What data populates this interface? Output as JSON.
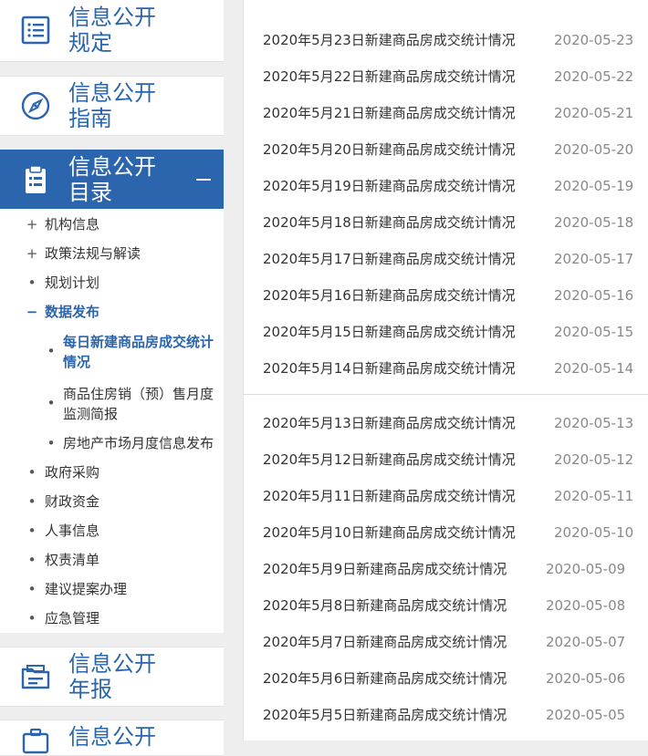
{
  "sidebar": {
    "sections": {
      "regulations": {
        "title_line1": "信息公开",
        "title_line2": "规定",
        "icon": "document-list-icon"
      },
      "guide": {
        "title_line1": "信息公开",
        "title_line2": "指南",
        "icon": "compass-icon"
      },
      "catalog": {
        "title_line1": "信息公开",
        "title_line2": "目录",
        "icon": "clipboard-icon",
        "expanded": true
      },
      "annual_report": {
        "title_line1": "信息公开",
        "title_line2": "年报",
        "icon": "folder-icon"
      },
      "next": {
        "title_line1": "信息公开",
        "icon": "briefcase-icon"
      }
    },
    "tree": {
      "items": [
        {
          "marker": "+",
          "label": "机构信息"
        },
        {
          "marker": "+",
          "label": "政策法规与解读"
        },
        {
          "marker": "•",
          "label": "规划计划"
        },
        {
          "marker": "−",
          "label": "数据发布"
        },
        {
          "marker": "•",
          "label": "政府采购"
        },
        {
          "marker": "•",
          "label": "财政资金"
        },
        {
          "marker": "•",
          "label": "人事信息"
        },
        {
          "marker": "•",
          "label": "权责清单"
        },
        {
          "marker": "•",
          "label": "建议提案办理"
        },
        {
          "marker": "•",
          "label": "应急管理"
        }
      ],
      "sub_items": [
        {
          "label": "每日新建商品房成交统计情况"
        },
        {
          "label": "商品住房销（预）售月度监测简报"
        },
        {
          "label": "房地产市场月度信息发布"
        }
      ]
    }
  },
  "content": {
    "list1": [
      {
        "title": "2020年5月23日新建商品房成交统计情况",
        "date": "2020-05-23"
      },
      {
        "title": "2020年5月22日新建商品房成交统计情况",
        "date": "2020-05-22"
      },
      {
        "title": "2020年5月21日新建商品房成交统计情况",
        "date": "2020-05-21"
      },
      {
        "title": "2020年5月20日新建商品房成交统计情况",
        "date": "2020-05-20"
      },
      {
        "title": "2020年5月19日新建商品房成交统计情况",
        "date": "2020-05-19"
      },
      {
        "title": "2020年5月18日新建商品房成交统计情况",
        "date": "2020-05-18"
      },
      {
        "title": "2020年5月17日新建商品房成交统计情况",
        "date": "2020-05-17"
      },
      {
        "title": "2020年5月16日新建商品房成交统计情况",
        "date": "2020-05-16"
      },
      {
        "title": "2020年5月15日新建商品房成交统计情况",
        "date": "2020-05-15"
      },
      {
        "title": "2020年5月14日新建商品房成交统计情况",
        "date": "2020-05-14"
      }
    ],
    "list2": [
      {
        "title": "2020年5月13日新建商品房成交统计情况",
        "date": "2020-05-13"
      },
      {
        "title": "2020年5月12日新建商品房成交统计情况",
        "date": "2020-05-12"
      },
      {
        "title": "2020年5月11日新建商品房成交统计情况",
        "date": "2020-05-11"
      },
      {
        "title": "2020年5月10日新建商品房成交统计情况",
        "date": "2020-05-10"
      },
      {
        "title": "2020年5月9日新建商品房成交统计情况",
        "date": "2020-05-09"
      },
      {
        "title": "2020年5月8日新建商品房成交统计情况",
        "date": "2020-05-08"
      },
      {
        "title": "2020年5月7日新建商品房成交统计情况",
        "date": "2020-05-07"
      },
      {
        "title": "2020年5月6日新建商品房成交统计情况",
        "date": "2020-05-06"
      },
      {
        "title": "2020年5月5日新建商品房成交统计情况",
        "date": "2020-05-05"
      }
    ]
  },
  "colors": {
    "brand_blue": "#2a65ad",
    "date_gray": "#888888",
    "text": "#333333"
  }
}
